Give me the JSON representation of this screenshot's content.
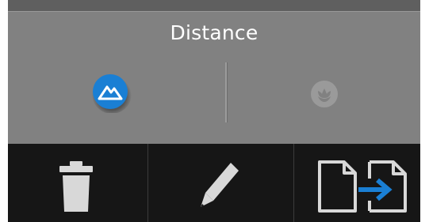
{
  "panel": {
    "title": "Distance",
    "modes": [
      {
        "icon": "mountain-landscape-icon",
        "state": "selected",
        "color": "#1a7fd4"
      },
      {
        "icon": "flower-macro-icon",
        "state": "unselected",
        "color": "#9a9a9a"
      }
    ]
  },
  "toolbar": {
    "buttons": [
      {
        "icon": "trash-icon"
      },
      {
        "icon": "pencil-icon"
      },
      {
        "icon": "copy-to-icon",
        "accent": "#1a7fd4"
      }
    ]
  },
  "colors": {
    "panel_bg": "#818181",
    "toolbar_bg": "#161616",
    "accent": "#1a7fd4"
  }
}
